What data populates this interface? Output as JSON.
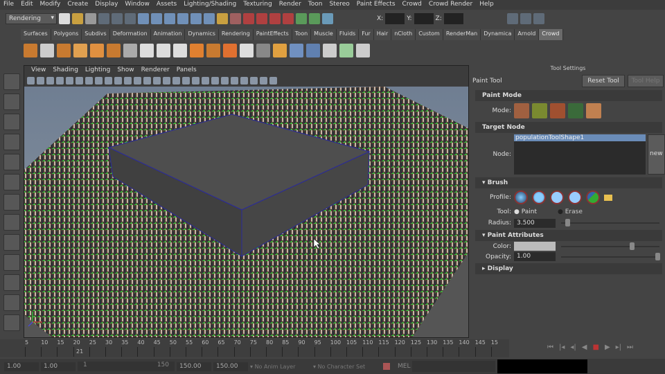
{
  "menu": [
    "File",
    "Edit",
    "Modify",
    "Create",
    "Display",
    "Window",
    "Assets",
    "Lighting/Shading",
    "Texturing",
    "Render",
    "Toon",
    "Stereo",
    "Paint Effects",
    "Crowd",
    "Crowd Render",
    "Help"
  ],
  "status": {
    "menu_set": "Rendering",
    "x_label": "X:",
    "y_label": "Y:",
    "z_label": "Z:"
  },
  "shelf_tabs": [
    "Surfaces",
    "Polygons",
    "Subdivs",
    "Deformation",
    "Animation",
    "Dynamics",
    "Rendering",
    "PaintEffects",
    "Toon",
    "Muscle",
    "Fluids",
    "Fur",
    "Hair",
    "nCloth",
    "Custom",
    "RenderMan",
    "Dynamica",
    "Arnold",
    "Crowd"
  ],
  "active_shelf": "Crowd",
  "viewport": {
    "menu": [
      "View",
      "Shading",
      "Lighting",
      "Show",
      "Renderer",
      "Panels"
    ]
  },
  "tool_settings": {
    "title": "Tool Settings",
    "tool_name": "Paint Tool",
    "reset": "Reset Tool",
    "help": "Tool Help",
    "paint_mode": "Paint Mode",
    "mode_label": "Mode:",
    "target_node": "Target Node",
    "node_label": "Node:",
    "node_value": "populationToolShape1",
    "new": "new",
    "brush": "Brush",
    "profile_label": "Profile:",
    "tool_label": "Tool:",
    "paint": "Paint",
    "erase": "Erase",
    "radius_label": "Radius:",
    "radius": "3.500",
    "paint_attributes": "Paint Attributes",
    "color_label": "Color:",
    "opacity_label": "Opacity:",
    "opacity": "1.00",
    "display": "Display"
  },
  "timeline": {
    "ticks": [
      "5",
      "10",
      "15",
      "20",
      "25",
      "30",
      "35",
      "40",
      "45",
      "50",
      "55",
      "60",
      "65",
      "70",
      "75",
      "80",
      "85",
      "90",
      "95",
      "100",
      "105",
      "110",
      "115",
      "120",
      "125",
      "130",
      "135",
      "140",
      "145",
      "15"
    ],
    "current": "21"
  },
  "range": {
    "start": "1.00",
    "anim_start": "1.00",
    "slider_start": "1",
    "slider_end": "150",
    "anim_end": "150.00",
    "end": "150.00",
    "anim_layer": "No Anim Layer",
    "char_set": "No Character Set",
    "mel": "MEL"
  }
}
